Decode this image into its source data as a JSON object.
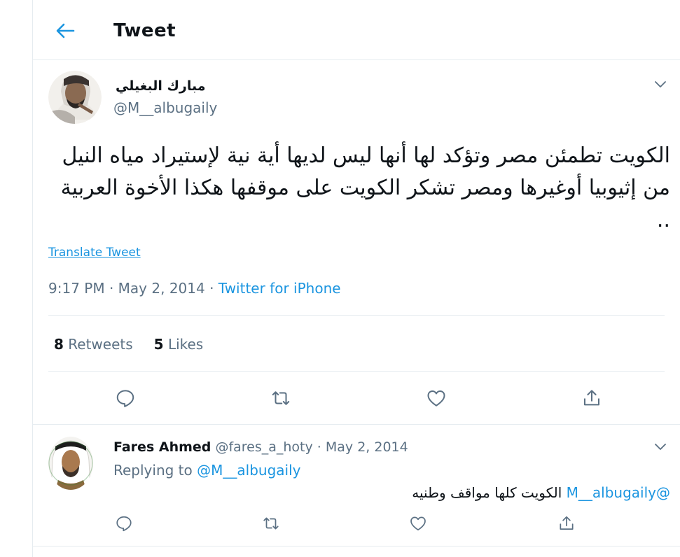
{
  "header": {
    "title": "Tweet",
    "back_icon": "arrow-left-icon"
  },
  "tweet": {
    "author_name": "مبارك البغيلي",
    "author_handle": "@M__albugaily",
    "text": "الكويت تطمئن مصر وتؤكد لها أنها ليس لديها أية نية لإستيراد مياه النيل من إثيوبيا أوغيرها ومصر تشكر الكويت على موقفها هكذا الأخوة العربية ..",
    "translate_label": "Translate Tweet",
    "time": "9:17 PM",
    "separator": " · ",
    "date": "May 2, 2014",
    "source": "Twitter for iPhone",
    "retweets_count": "8",
    "retweets_label": "Retweets",
    "likes_count": "5",
    "likes_label": "Likes"
  },
  "reply": {
    "author_name": "Fares Ahmed",
    "author_handle": "@fares_a_hoty",
    "separator": " · ",
    "date": "May 2, 2014",
    "replying_label": "Replying to",
    "replying_to": "@M__albugaily",
    "mention": "@M__albugaily",
    "text": "الكويت كلها مواقف وطنيه"
  },
  "colors": {
    "accent": "#1b95e0",
    "secondary_text": "#5b7083",
    "divider": "#e6ecf0"
  },
  "icons": [
    "arrow-left-icon",
    "chevron-down-icon",
    "reply-icon",
    "retweet-icon",
    "like-icon",
    "share-icon"
  ]
}
